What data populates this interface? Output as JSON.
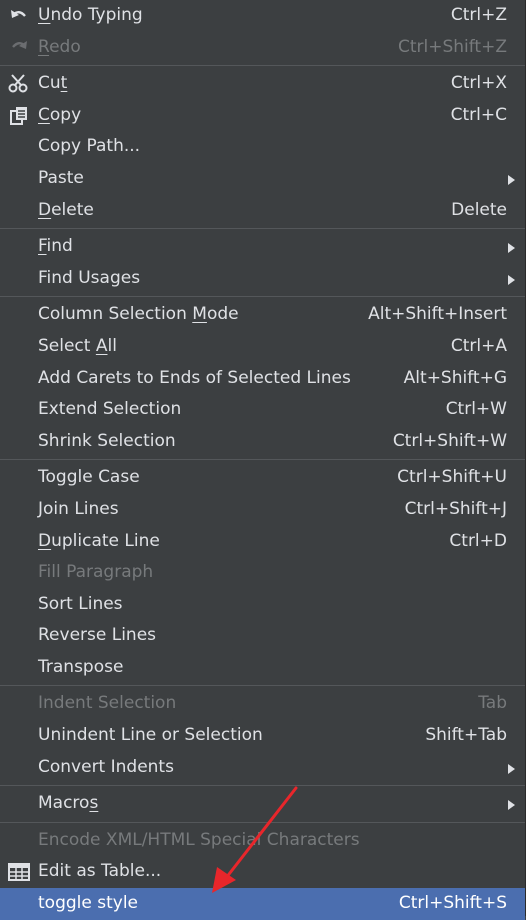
{
  "colors": {
    "background": "#3c3f41",
    "text": "#dfe1e5",
    "disabled_text": "#777a7c",
    "selection_bg": "#4b6eaf",
    "separator": "#54575a",
    "annotation_arrow": "#e8262b"
  },
  "menu": {
    "items": [
      {
        "name": "undo-typing",
        "mnemonic": "U",
        "rest": "ndo Typing",
        "shortcut": "Ctrl+Z",
        "icon": "undo-icon"
      },
      {
        "name": "redo",
        "mnemonic": "R",
        "rest": "edo",
        "shortcut": "Ctrl+Shift+Z",
        "icon": "redo-icon",
        "disabled": true
      },
      {
        "name": "cut",
        "pre": "Cu",
        "mnemonic": "t",
        "shortcut": "Ctrl+X",
        "icon": "scissors-icon"
      },
      {
        "name": "copy",
        "mnemonic": "C",
        "rest": "opy",
        "shortcut": "Ctrl+C",
        "icon": "copy-icon"
      },
      {
        "name": "copy-path",
        "label": "Copy Path..."
      },
      {
        "name": "paste",
        "label": "Paste",
        "submenu": true
      },
      {
        "name": "delete",
        "mnemonic": "D",
        "rest": "elete",
        "shortcut": "Delete"
      },
      {
        "name": "find",
        "mnemonic": "F",
        "rest": "ind",
        "submenu": true
      },
      {
        "name": "find-usages",
        "label": "Find Usages",
        "submenu": true
      },
      {
        "name": "column-selection-mode",
        "pre": "Column Selection ",
        "mnemonic": "M",
        "rest": "ode",
        "shortcut": "Alt+Shift+Insert"
      },
      {
        "name": "select-all",
        "pre": "Select ",
        "mnemonic": "A",
        "rest": "ll",
        "shortcut": "Ctrl+A"
      },
      {
        "name": "add-carets",
        "label": "Add Carets to Ends of Selected Lines",
        "shortcut": "Alt+Shift+G"
      },
      {
        "name": "extend-selection",
        "label": "Extend Selection",
        "shortcut": "Ctrl+W"
      },
      {
        "name": "shrink-selection",
        "label": "Shrink Selection",
        "shortcut": "Ctrl+Shift+W"
      },
      {
        "name": "toggle-case",
        "label": "Toggle Case",
        "shortcut": "Ctrl+Shift+U"
      },
      {
        "name": "join-lines",
        "label": "Join Lines",
        "shortcut": "Ctrl+Shift+J"
      },
      {
        "name": "duplicate-line",
        "mnemonic": "D",
        "rest": "uplicate Line",
        "shortcut": "Ctrl+D"
      },
      {
        "name": "fill-paragraph",
        "label": "Fill Paragraph",
        "disabled": true
      },
      {
        "name": "sort-lines",
        "label": "Sort Lines"
      },
      {
        "name": "reverse-lines",
        "label": "Reverse Lines"
      },
      {
        "name": "transpose",
        "label": "Transpose"
      },
      {
        "name": "indent-selection",
        "label": "Indent Selection",
        "shortcut": "Tab",
        "disabled": true
      },
      {
        "name": "unindent-line",
        "label": "Unindent Line or Selection",
        "shortcut": "Shift+Tab"
      },
      {
        "name": "convert-indents",
        "label": "Convert Indents",
        "submenu": true
      },
      {
        "name": "macros",
        "pre": "Macro",
        "mnemonic": "s",
        "submenu": true
      },
      {
        "name": "encode-xml",
        "label": "Encode XML/HTML Special Characters",
        "disabled": true
      },
      {
        "name": "edit-as-table",
        "label": "Edit as Table...",
        "icon": "table-icon"
      },
      {
        "name": "toggle-style",
        "label": "toggle style",
        "shortcut": "Ctrl+Shift+S",
        "selected": true
      }
    ]
  }
}
